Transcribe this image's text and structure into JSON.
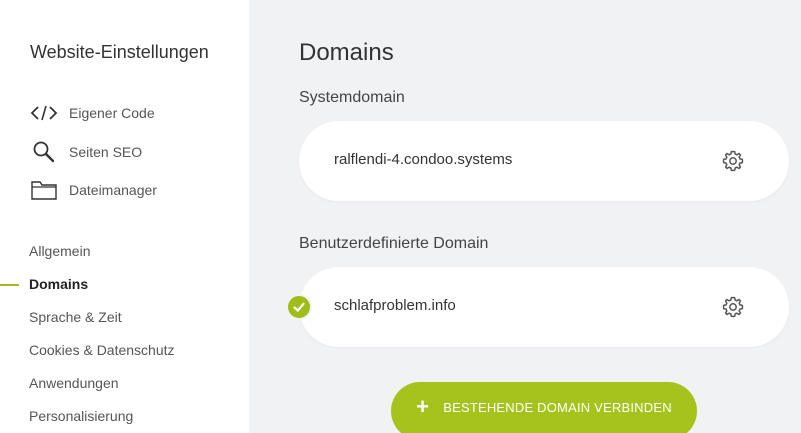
{
  "sidebar": {
    "title": "Website-Einstellungen",
    "tools": [
      {
        "label": "Eigener Code",
        "icon": "code-icon"
      },
      {
        "label": "Seiten SEO",
        "icon": "search-icon"
      },
      {
        "label": "Dateimanager",
        "icon": "folder-icon"
      }
    ],
    "nav": [
      {
        "label": "Allgemein",
        "active": false
      },
      {
        "label": "Domains",
        "active": true
      },
      {
        "label": "Sprache & Zeit",
        "active": false
      },
      {
        "label": "Cookies & Datenschutz",
        "active": false
      },
      {
        "label": "Anwendungen",
        "active": false
      },
      {
        "label": "Personalisierung",
        "active": false
      }
    ]
  },
  "main": {
    "title": "Domains",
    "system_section": {
      "label": "Systemdomain",
      "domain": "ralflendi-4.condoo.systems"
    },
    "custom_section": {
      "label": "Benutzerdefinierte Domain",
      "domain": "schlafproblem.info",
      "verified": true
    },
    "connect_button": {
      "icon": "plus-icon",
      "label": "BESTEHENDE DOMAIN VERBINDEN"
    }
  },
  "colors": {
    "accent": "#a6c21c",
    "background": "#f1f2f4",
    "sidebar": "#ffffff"
  }
}
